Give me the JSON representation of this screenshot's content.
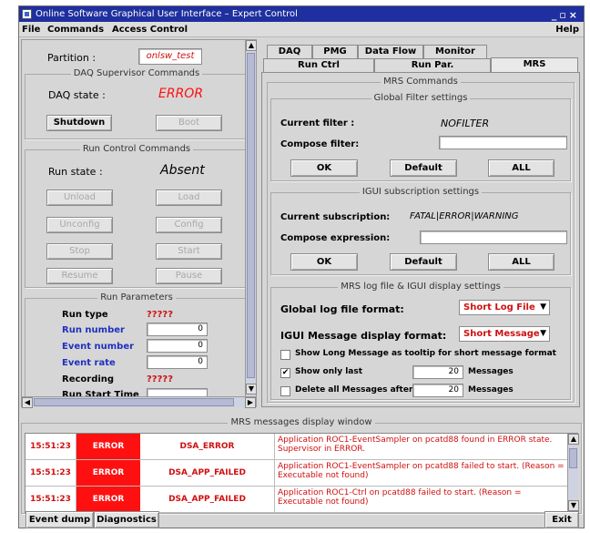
{
  "window": {
    "title": "Online Software Graphical User Interface – Expert Control",
    "controls": "_▫×"
  },
  "menu": {
    "file": "File",
    "commands": "Commands",
    "access_control": "Access Control",
    "help": "Help"
  },
  "left": {
    "partition_label": "Partition :",
    "partition_value": "onlsw_test",
    "daq_group_title": "DAQ Supervisor Commands",
    "daq_state_label": "DAQ state :",
    "daq_state_value": "ERROR",
    "shutdown": "Shutdown",
    "boot": "Boot",
    "run_group_title": "Run Control Commands",
    "run_state_label": "Run state :",
    "run_state_value": "Absent",
    "unload": "Unload",
    "load": "Load",
    "unconfig": "Unconfig",
    "config": "Config",
    "stop": "Stop",
    "start": "Start",
    "resume": "Resume",
    "pause": "Pause",
    "params_title": "Run Parameters",
    "run_type_label": "Run type",
    "run_type_value": "?????",
    "run_number_label": "Run number",
    "run_number_value": "0",
    "event_number_label": "Event number",
    "event_number_value": "0",
    "event_rate_label": "Event rate",
    "event_rate_value": "0",
    "recording_label": "Recording",
    "recording_value": "?????",
    "run_start_label": "Run Start Time"
  },
  "tabs": {
    "row1": [
      "DAQ Sup.",
      "PMG",
      "Data Flow",
      "Monitor"
    ],
    "row2": [
      "Run Ctrl",
      "Run Par.",
      "MRS"
    ]
  },
  "mrs": {
    "title": "MRS Commands",
    "global_filter_title": "Global Filter settings",
    "current_filter_label": "Current filter :",
    "current_filter_value": "NOFILTER",
    "compose_filter_label": "Compose filter:",
    "compose_filter_value": "",
    "ok": "OK",
    "default": "Default",
    "all": "ALL",
    "igui_sub_title": "IGUI subscription settings",
    "current_sub_label": "Current subscription:",
    "current_sub_value": "FATAL|ERROR|WARNING",
    "compose_expr_label": "Compose expression:",
    "compose_expr_value": "",
    "log_title": "MRS log file & IGUI display settings",
    "global_log_label": "Global log file format:",
    "global_log_value": "Short Log File",
    "igui_msg_label": "IGUI Message display format:",
    "igui_msg_value": "Short Message",
    "tooltip_label": "Show Long Message as tooltip for short message format",
    "tooltip_checked": false,
    "show_only_last_label": "Show only last",
    "show_only_last_checked": true,
    "show_only_last_value": "20",
    "messages_unit": "Messages",
    "delete_after_label": "Delete all Messages after",
    "delete_after_checked": false,
    "delete_after_value": "20"
  },
  "messages_window": {
    "title": "MRS messages display window",
    "rows": [
      {
        "time": "15:51:23",
        "status": "ERROR",
        "name": "DSA_ERROR",
        "text": "Application ROC1-EventSampler on pcatd88 found in ERROR state. Supervisor in ERROR."
      },
      {
        "time": "15:51:23",
        "status": "ERROR",
        "name": "DSA_APP_FAILED",
        "text": "Application ROC1-EventSampler on pcatd88 failed to start. (Reason = Executable not found)"
      },
      {
        "time": "15:51:23",
        "status": "ERROR",
        "name": "DSA_APP_FAILED",
        "text": "Application ROC1-Ctrl on pcatd88 failed to start. (Reason = Executable not found)"
      }
    ]
  },
  "bottom": {
    "event_dump": "Event dump",
    "diagnostics": "Diagnostics",
    "exit": "Exit"
  },
  "colors": {
    "title_bar": "#1f2f9f",
    "error_red": "#ff1010",
    "label_blue": "#2030c0"
  }
}
